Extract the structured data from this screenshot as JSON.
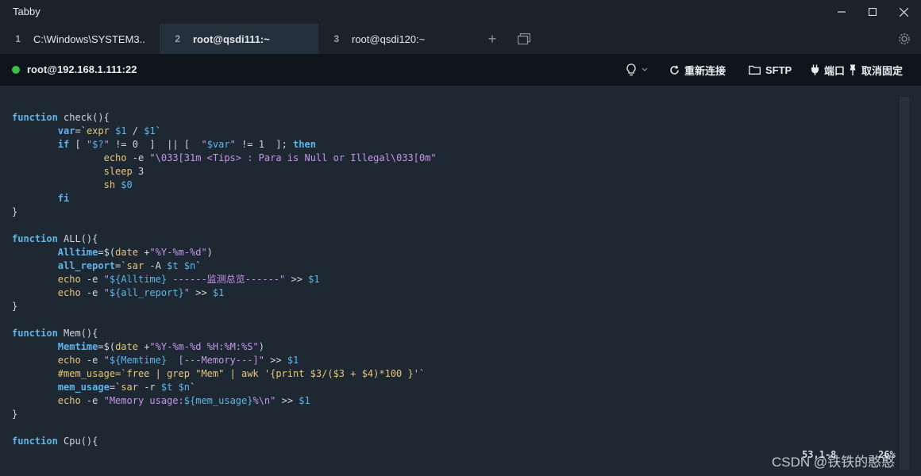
{
  "window": {
    "title": "Tabby",
    "controls": [
      "minimize-icon",
      "maximize-icon",
      "close-icon"
    ]
  },
  "tabs": [
    {
      "num": "1",
      "label": "C:\\Windows\\SYSTEM3...",
      "active": false
    },
    {
      "num": "2",
      "label": "root@qsdi111:~",
      "active": true
    },
    {
      "num": "3",
      "label": "root@qsdi120:~",
      "active": false
    }
  ],
  "toolbar": {
    "status_color": "#3bbf4a",
    "host": "root@192.168.1.111:22",
    "reconnect_label": "重新连接",
    "sftp_label": "SFTP",
    "port_label": "端口",
    "unpin_label": "取消固定"
  },
  "code_lines": [
    "",
    "function check(){",
    "        var=`expr $1 / $1`",
    "        if [ \"$?\" != 0  ]  || [  \"$var\" != 1  ]; then",
    "                echo -e \"\\033[31m <Tips> : Para is Null or Illegal\\033[0m\"",
    "                sleep 3",
    "                sh $0",
    "        fi",
    "}",
    "",
    "function ALL(){",
    "        Alltime=$(date +\"%Y-%m-%d\")",
    "        all_report=`sar -A $t $n`",
    "        echo -e \"${Alltime} ------监测总览------\" >> $1",
    "        echo -e \"${all_report}\" >> $1",
    "}",
    "",
    "function Mem(){",
    "        Memtime=$(date +\"%Y-%m-%d %H:%M:%S\")",
    "        echo -e \"${Memtime}  [---Memory---]\" >> $1",
    "        #mem_usage=`free | grep \"Mem\" | awk '{print $3/($3 + $4)*100 }'`",
    "        mem_usage=`sar -r $t $n`",
    "        echo -e \"Memory usage:${mem_usage}%\\n\" >> $1",
    "}",
    "",
    "function Cpu(){"
  ],
  "status": {
    "position": "53,1-8",
    "percent": "26%"
  },
  "watermark": "CSDN @铁铁的憨憨"
}
